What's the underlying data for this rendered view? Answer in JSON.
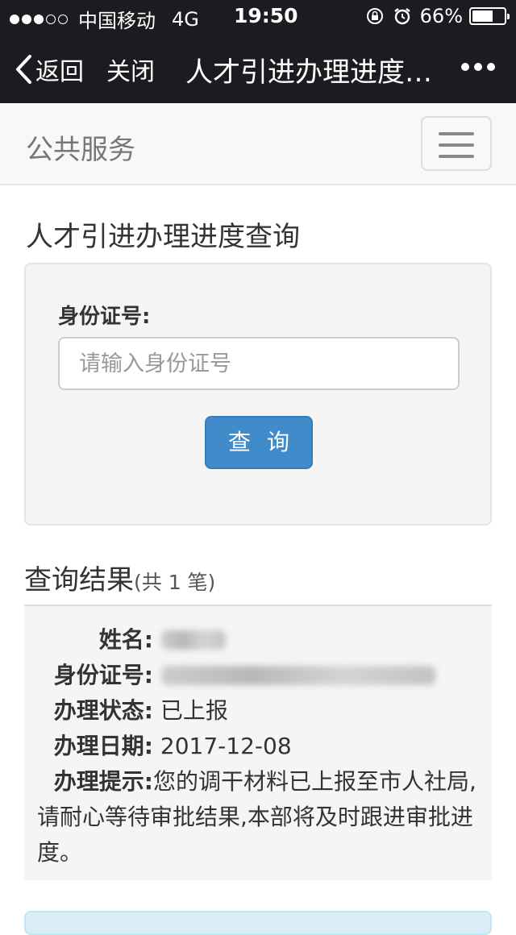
{
  "status_bar": {
    "carrier": "中国移动",
    "network": "4G",
    "time": "19:50",
    "battery": "66%",
    "battery_level": 0.66,
    "signal_bars_filled": 3,
    "signal_bars_total": 5
  },
  "wechat_nav": {
    "back_label": "返回",
    "close_label": "关闭",
    "title": "人才引进办理进度查询"
  },
  "navbar": {
    "brand": "公共服务"
  },
  "query": {
    "heading": "人才引进办理进度查询",
    "id_label": "身份证号:",
    "id_placeholder": "请输入身份证号",
    "id_value": "",
    "search_button": "查询"
  },
  "result": {
    "heading": "查询结果",
    "count_text": "(共 1 笔)",
    "fields": {
      "name_key": "姓名:",
      "id_key": "身份证号:",
      "status_key": "办理状态:",
      "status_value": "已上报",
      "date_key": "办理日期:",
      "date_value": "2017-12-08",
      "tip_key": "办理提示:",
      "tip_value": "您的调干材料已上报至市人社局,请耐心等待审批结果,本部将及时跟进审批进度。"
    }
  },
  "colors": {
    "primary_button": "#428bca",
    "wechat_bar": "#1b1c20"
  }
}
